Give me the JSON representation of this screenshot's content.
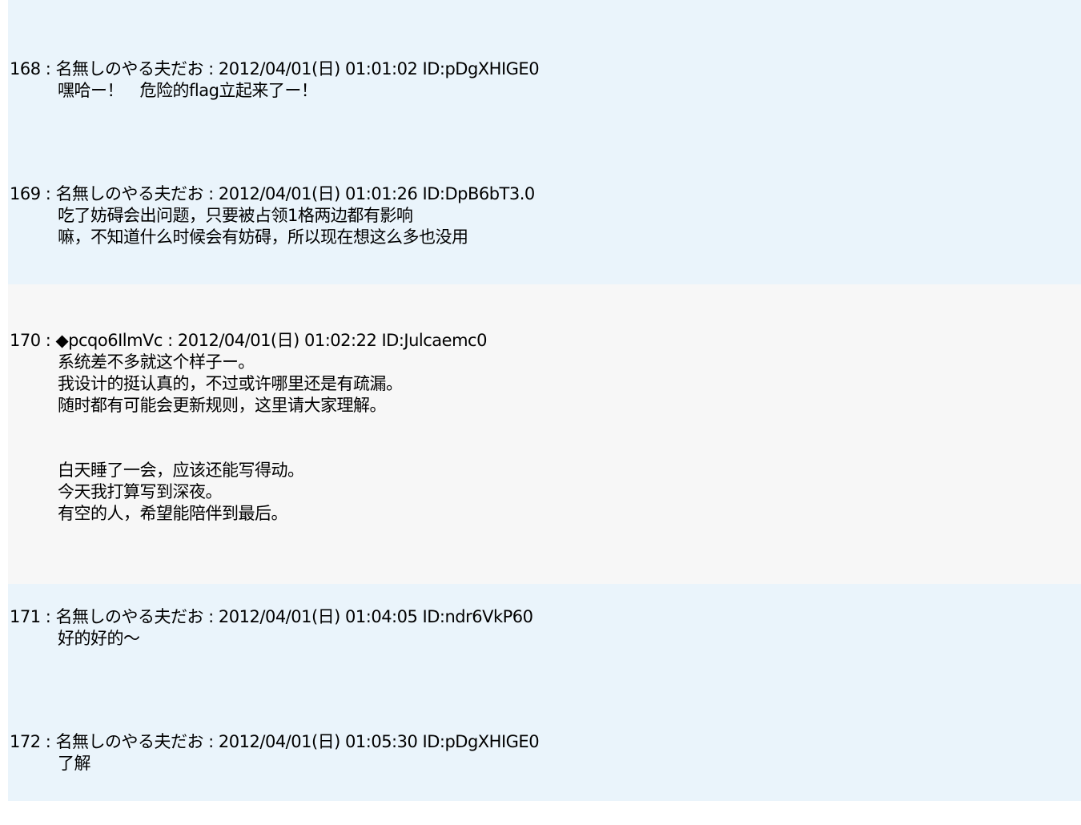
{
  "colors": {
    "blue_block": "#eaf4fb",
    "gray_block": "#f7f7f7"
  },
  "posts": [
    {
      "header": "168 : 名無しのやる夫だお : 2012/04/01(日) 01:01:02 ID:pDgXHIGE0",
      "lines": [
        "嘿哈ー！　危险的flag立起来了ー！"
      ]
    },
    {
      "header": "169 : 名無しのやる夫だお : 2012/04/01(日) 01:01:26 ID:DpB6bT3.0",
      "lines": [
        "吃了妨碍会出问题，只要被占领1格两边都有影响",
        "嘛，不知道什么时候会有妨碍，所以现在想这么多也没用"
      ]
    },
    {
      "header": "170 : ◆pcqo6IlmVc : 2012/04/01(日) 01:02:22 ID:Julcaemc0",
      "lines": [
        "系统差不多就这个样子ー。",
        "我设计的挺认真的，不过或许哪里还是有疏漏。",
        "随时都有可能会更新规则，这里请大家理解。",
        "",
        "",
        "白天睡了一会，应该还能写得动。",
        "今天我打算写到深夜。",
        "有空的人，希望能陪伴到最后。"
      ]
    },
    {
      "header": "171 : 名無しのやる夫だお : 2012/04/01(日) 01:04:05 ID:ndr6VkP60",
      "lines": [
        "好的好的～"
      ]
    },
    {
      "header": "172 : 名無しのやる夫だお : 2012/04/01(日) 01:05:30 ID:pDgXHIGE0",
      "lines": [
        "了解"
      ]
    }
  ]
}
